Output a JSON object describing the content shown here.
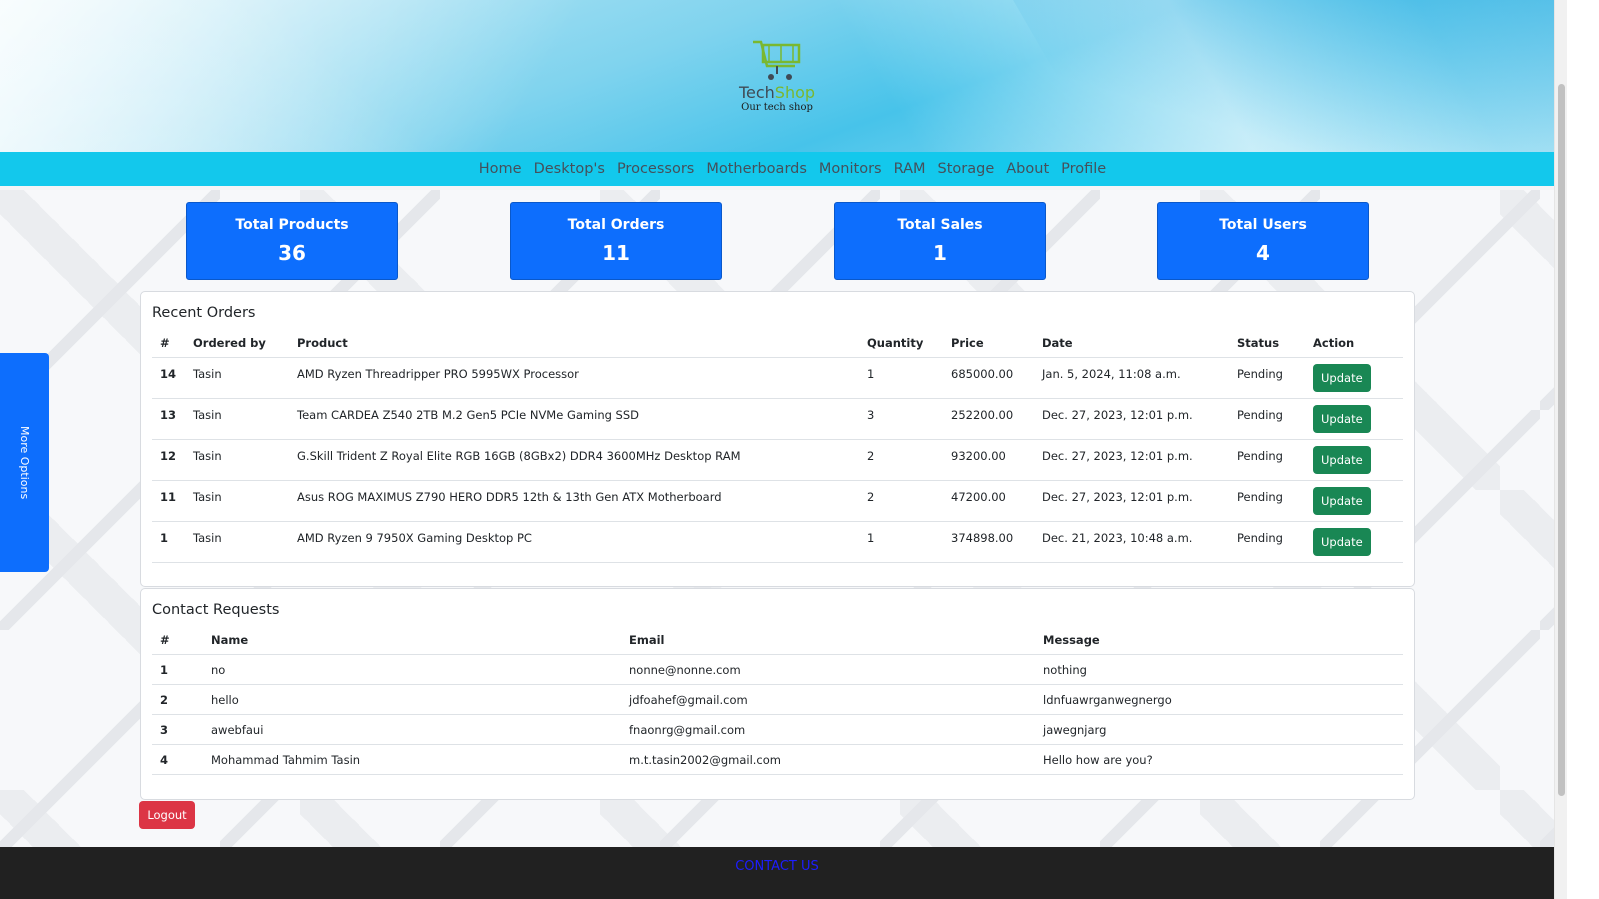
{
  "brand": {
    "name_part1": "Tech",
    "name_part2": "Shop",
    "tagline": "Our tech shop",
    "logo_icon": "cart-icon",
    "accent_color": "#7ab830"
  },
  "nav": {
    "items": [
      "Home",
      "Desktop's",
      "Processors",
      "Motherboards",
      "Monitors",
      "RAM",
      "Storage",
      "About",
      "Profile"
    ]
  },
  "stats": [
    {
      "title": "Total Products",
      "value": "36"
    },
    {
      "title": "Total Orders",
      "value": "11"
    },
    {
      "title": "Total Sales",
      "value": "1"
    },
    {
      "title": "Total Users",
      "value": "4"
    }
  ],
  "side_tab": {
    "label": "More Options"
  },
  "orders": {
    "title": "Recent Orders",
    "headers": [
      "#",
      "Ordered by",
      "Product",
      "Quantity",
      "Price",
      "Date",
      "Status",
      "Action"
    ],
    "action_label": "Update",
    "rows": [
      {
        "id": "14",
        "by": "Tasin",
        "product": "AMD Ryzen Threadripper PRO 5995WX Processor",
        "qty": "1",
        "price": "685000.00",
        "date": "Jan. 5, 2024, 11:08 a.m.",
        "status": "Pending"
      },
      {
        "id": "13",
        "by": "Tasin",
        "product": "Team CARDEA Z540 2TB M.2 Gen5 PCIe NVMe Gaming SSD",
        "qty": "3",
        "price": "252200.00",
        "date": "Dec. 27, 2023, 12:01 p.m.",
        "status": "Pending"
      },
      {
        "id": "12",
        "by": "Tasin",
        "product": "G.Skill Trident Z Royal Elite RGB 16GB (8GBx2) DDR4 3600MHz Desktop RAM",
        "qty": "2",
        "price": "93200.00",
        "date": "Dec. 27, 2023, 12:01 p.m.",
        "status": "Pending"
      },
      {
        "id": "11",
        "by": "Tasin",
        "product": "Asus ROG MAXIMUS Z790 HERO DDR5 12th & 13th Gen ATX Motherboard",
        "qty": "2",
        "price": "47200.00",
        "date": "Dec. 27, 2023, 12:01 p.m.",
        "status": "Pending"
      },
      {
        "id": "1",
        "by": "Tasin",
        "product": "AMD Ryzen 9 7950X Gaming Desktop PC",
        "qty": "1",
        "price": "374898.00",
        "date": "Dec. 21, 2023, 10:48 a.m.",
        "status": "Pending"
      }
    ]
  },
  "contacts": {
    "title": "Contact Requests",
    "headers": [
      "#",
      "Name",
      "Email",
      "Message"
    ],
    "rows": [
      {
        "id": "1",
        "name": "no",
        "email": "nonne@nonne.com",
        "message": "nothing"
      },
      {
        "id": "2",
        "name": "hello",
        "email": "jdfoahef@gmail.com",
        "message": "ldnfuawrganwegnergo"
      },
      {
        "id": "3",
        "name": "awebfaui",
        "email": "fnaonrg@gmail.com",
        "message": "jawegnjarg"
      },
      {
        "id": "4",
        "name": "Mohammad Tahmim Tasin",
        "email": "m.t.tasin2002@gmail.com",
        "message": "Hello how are you?"
      }
    ]
  },
  "logout_label": "Logout",
  "footer": {
    "contact_label": "CONTACT US"
  }
}
